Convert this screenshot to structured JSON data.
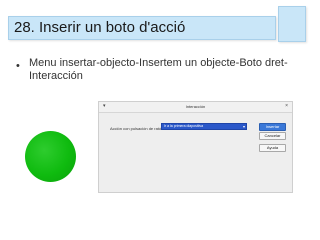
{
  "slide": {
    "title": "28. Inserir un boto d'acció",
    "bullet_marker": "•",
    "bullet_text": "Menu insertar-objecto-Insertem un objecte-Boto dret-Interacción"
  },
  "dialog": {
    "menu_icon": "▾",
    "title": "Interacción",
    "close_icon": "×",
    "action_label": "Acción con pulsación de ratón",
    "action_value": "Ir a la primera diapositiva",
    "select_arrow": "▾",
    "buttons": {
      "insert": "Insertar",
      "cancel": "Cancelar",
      "help": "Ayuda"
    }
  },
  "colors": {
    "title_bar": "#c9e6f8",
    "circle": "#11bb11",
    "select_highlight": "#2b58c9"
  },
  "icons": {
    "dialog_menu": "menu-icon",
    "dialog_close": "close-icon",
    "dropdown": "chevron-down-icon"
  }
}
